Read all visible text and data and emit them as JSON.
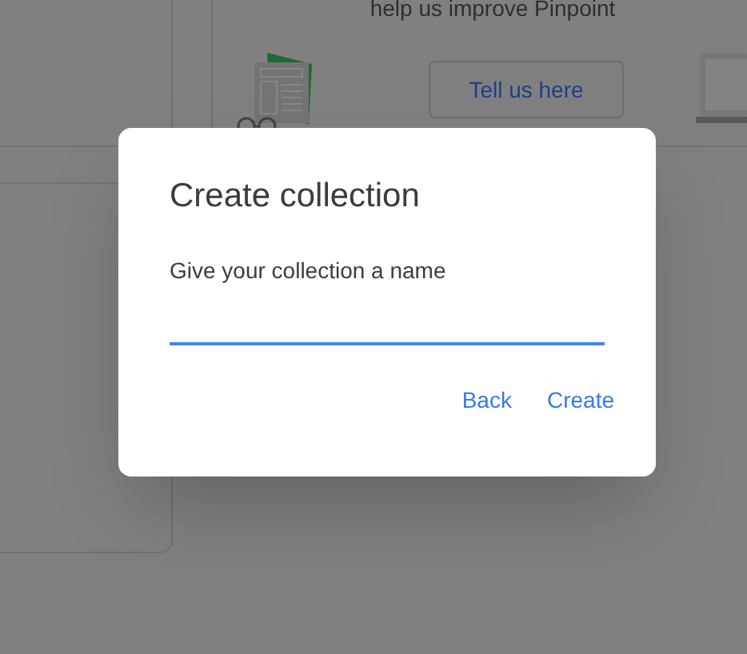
{
  "background": {
    "feedback_prompt": "help us improve Pinpoint",
    "feedback_button": "Tell us here"
  },
  "dialog": {
    "title": "Create collection",
    "field_label": "Give your collection a name",
    "field": {
      "focused": true
    },
    "buttons": [
      {
        "label": "Back"
      },
      {
        "label": "Create"
      }
    ]
  }
}
